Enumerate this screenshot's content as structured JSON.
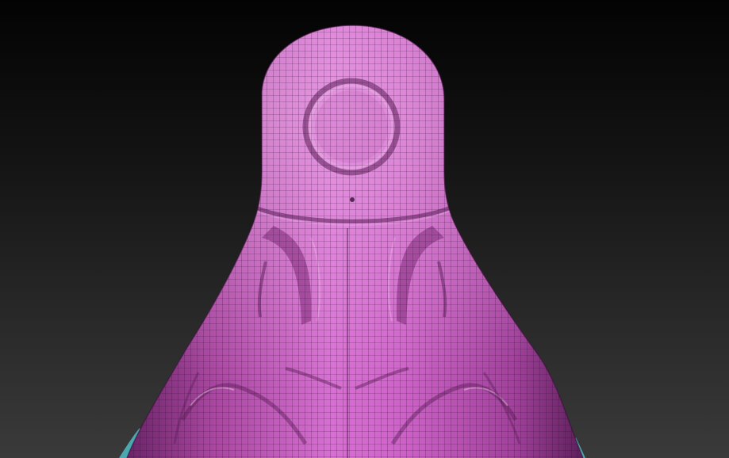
{
  "viewport": {
    "background_top": "#030303",
    "background_bottom": "#3a3a3a"
  },
  "model": {
    "kind": "sculpted mesh",
    "body_color": "#c85ec4",
    "body_shadow": "#6b2468",
    "body_highlight": "#e6a2e2",
    "wireframe_color": "#2a0d2a",
    "accent_color": "#4aa9b0",
    "polyframe_visible": true
  }
}
